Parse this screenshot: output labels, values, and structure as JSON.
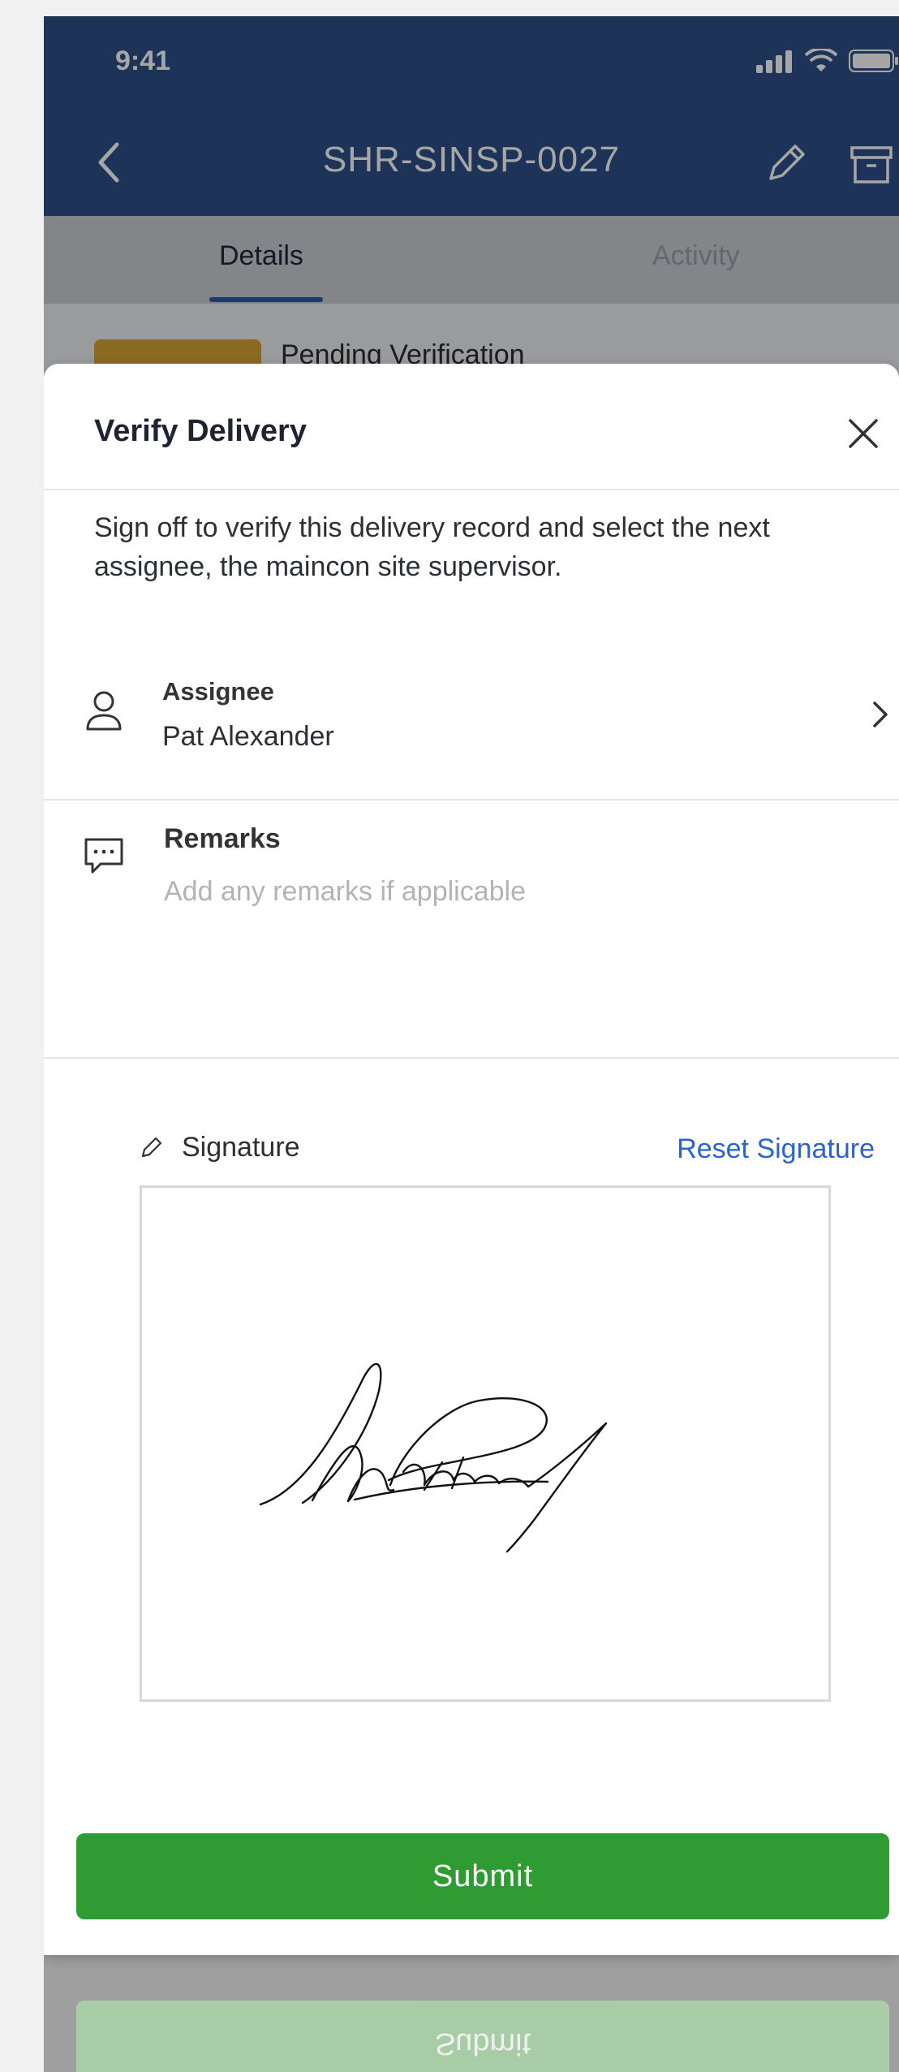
{
  "status_bar": {
    "time": "9:41"
  },
  "header": {
    "title": "SHR-SINSP-0027"
  },
  "tabs": [
    {
      "label": "Details",
      "active": true
    },
    {
      "label": "Activity",
      "active": false
    }
  ],
  "background_record": {
    "status_text": "Pending Verification"
  },
  "modal": {
    "title": "Verify Delivery",
    "intro": "Sign off to verify this delivery record and select the next assignee, the maincon site supervisor.",
    "assignee": {
      "label": "Assignee",
      "value": "Pat Alexander"
    },
    "remarks": {
      "label": "Remarks",
      "placeholder": "Add any remarks if applicable",
      "value": ""
    },
    "signature": {
      "label": "Signature",
      "reset_label": "Reset Signature"
    },
    "submit_label": "Submit"
  },
  "reflection": {
    "label": "Submit"
  },
  "colors": {
    "header": "#2d4f86",
    "accent_link": "#2d63c8",
    "submit": "#2e9b33",
    "badge": "#d4a232"
  }
}
